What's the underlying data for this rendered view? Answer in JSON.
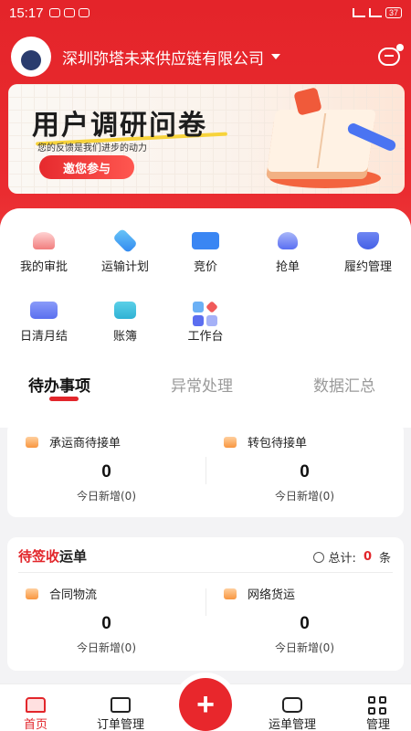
{
  "status_bar": {
    "time": "15:17",
    "battery": "37"
  },
  "header": {
    "company": "深圳弥塔未来供应链有限公司"
  },
  "banner": {
    "title": "用户调研问卷",
    "subtitle": "您的反馈是我们进步的动力",
    "button": "邀您参与"
  },
  "menu": [
    {
      "label": "我的审批",
      "icon": "approval-icon"
    },
    {
      "label": "运输计划",
      "icon": "transport-plan-icon"
    },
    {
      "label": "竞价",
      "icon": "bidding-icon"
    },
    {
      "label": "抢单",
      "icon": "grab-order-icon"
    },
    {
      "label": "履约管理",
      "icon": "contract-icon"
    },
    {
      "label": "日清月结",
      "icon": "calendar-icon"
    },
    {
      "label": "账簿",
      "icon": "ledger-icon"
    },
    {
      "label": "工作台",
      "icon": "workbench-icon"
    }
  ],
  "tabs": [
    {
      "label": "待办事项",
      "active": true
    },
    {
      "label": "异常处理",
      "active": false
    },
    {
      "label": "数据汇总",
      "active": false
    }
  ],
  "todo": {
    "cells": [
      {
        "title": "承运商待接单",
        "count": "0",
        "sub": "今日新增(0)"
      },
      {
        "title": "转包待接单",
        "count": "0",
        "sub": "今日新增(0)"
      }
    ]
  },
  "pending": {
    "title_red": "待签收",
    "title_rest": "运单",
    "total_label": "总计:",
    "total_value": "0",
    "total_unit": "条",
    "cells": [
      {
        "title": "合同物流",
        "count": "0",
        "sub": "今日新增(0)"
      },
      {
        "title": "网络货运",
        "count": "0",
        "sub": "今日新增(0)"
      }
    ]
  },
  "bottom_nav": [
    {
      "label": "首页",
      "active": true
    },
    {
      "label": "订单管理",
      "active": false
    },
    {
      "label": "运单管理",
      "active": false
    },
    {
      "label": "管理",
      "active": false
    }
  ],
  "fab": "+",
  "colors": {
    "brand_red": "#e2262b",
    "header_red": "#e4242a"
  }
}
